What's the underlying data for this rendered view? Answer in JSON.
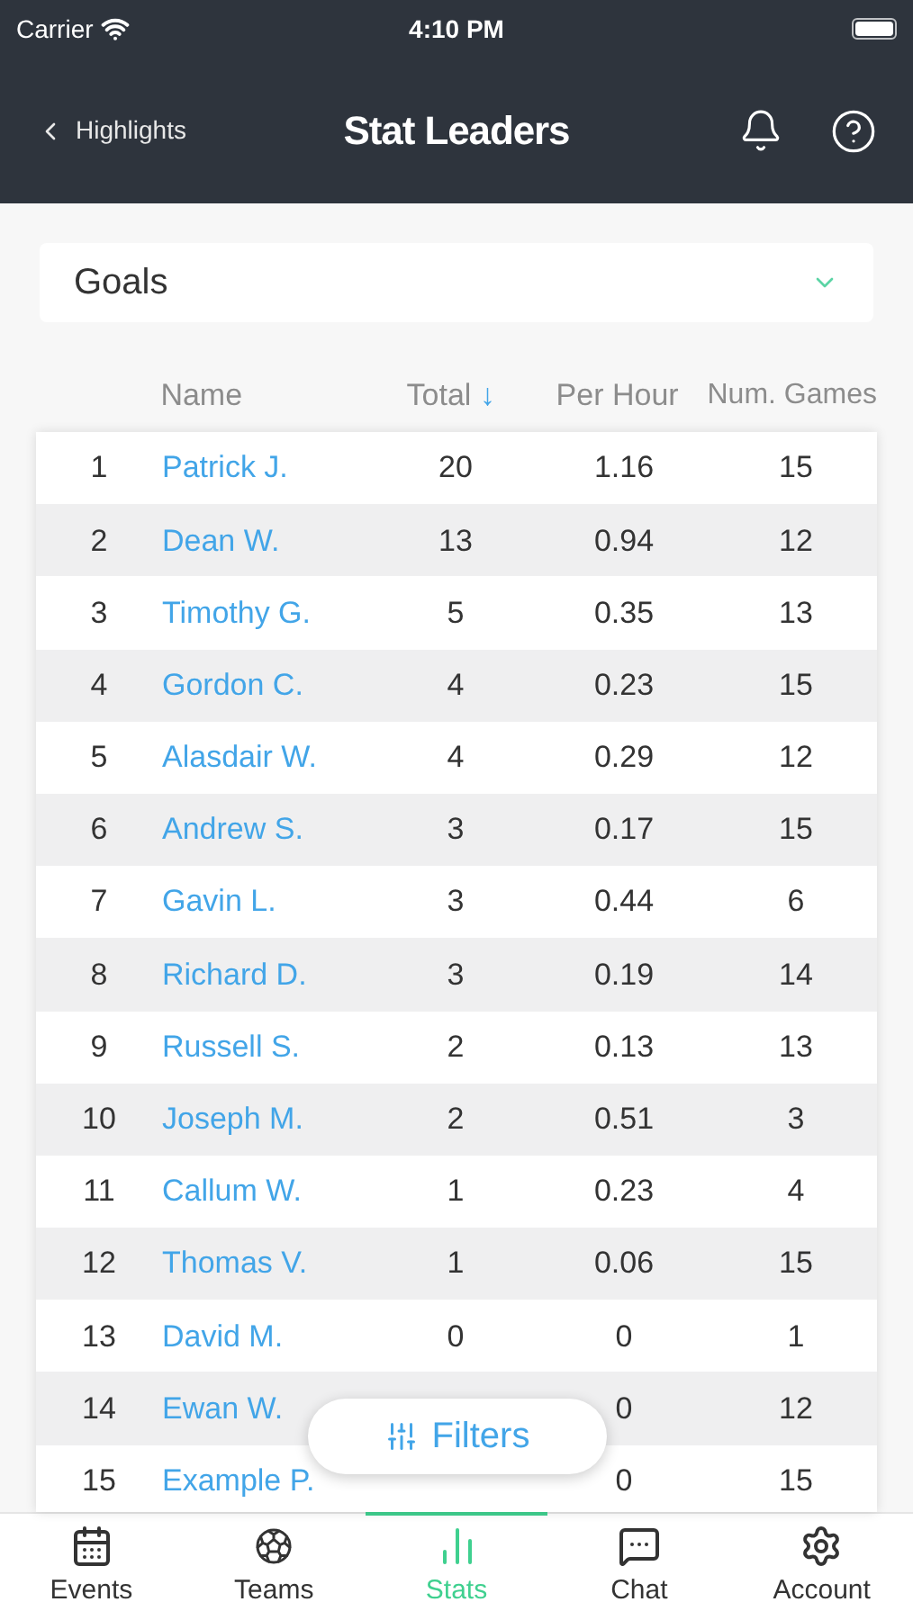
{
  "status_bar": {
    "carrier": "Carrier",
    "time": "4:10 PM"
  },
  "nav": {
    "back_label": "Highlights",
    "title": "Stat Leaders"
  },
  "stat_select": {
    "value": "Goals"
  },
  "table": {
    "columns": [
      {
        "label": "Name"
      },
      {
        "label": "Total",
        "sort_arrow": "↓"
      },
      {
        "label": "Per Hour"
      },
      {
        "label": "Num. Games"
      }
    ],
    "rows": [
      {
        "rank": "1",
        "name": "Patrick J.",
        "total": "20",
        "per_hour": "1.16",
        "games": "15"
      },
      {
        "rank": "2",
        "name": "Dean W.",
        "total": "13",
        "per_hour": "0.94",
        "games": "12"
      },
      {
        "rank": "3",
        "name": "Timothy G.",
        "total": "5",
        "per_hour": "0.35",
        "games": "13"
      },
      {
        "rank": "4",
        "name": "Gordon C.",
        "total": "4",
        "per_hour": "0.23",
        "games": "15"
      },
      {
        "rank": "5",
        "name": "Alasdair W.",
        "total": "4",
        "per_hour": "0.29",
        "games": "12"
      },
      {
        "rank": "6",
        "name": "Andrew S.",
        "total": "3",
        "per_hour": "0.17",
        "games": "15"
      },
      {
        "rank": "7",
        "name": "Gavin L.",
        "total": "3",
        "per_hour": "0.44",
        "games": "6"
      },
      {
        "rank": "8",
        "name": "Richard D.",
        "total": "3",
        "per_hour": "0.19",
        "games": "14"
      },
      {
        "rank": "9",
        "name": "Russell S.",
        "total": "2",
        "per_hour": "0.13",
        "games": "13"
      },
      {
        "rank": "10",
        "name": "Joseph M.",
        "total": "2",
        "per_hour": "0.51",
        "games": "3"
      },
      {
        "rank": "11",
        "name": "Callum W.",
        "total": "1",
        "per_hour": "0.23",
        "games": "4"
      },
      {
        "rank": "12",
        "name": "Thomas V.",
        "total": "1",
        "per_hour": "0.06",
        "games": "15"
      },
      {
        "rank": "13",
        "name": "David M.",
        "total": "0",
        "per_hour": "0",
        "games": "1"
      },
      {
        "rank": "14",
        "name": "Ewan W.",
        "per_hour": "0",
        "games": "12"
      },
      {
        "rank": "15",
        "name": "Example P.",
        "per_hour": "0",
        "games": "15"
      }
    ]
  },
  "filters_button": {
    "label": "Filters"
  },
  "tab_bar": [
    {
      "kind": "events",
      "label": "Events",
      "selected": false
    },
    {
      "kind": "teams",
      "label": "Teams",
      "selected": false
    },
    {
      "kind": "stats",
      "label": "Stats",
      "selected": true
    },
    {
      "kind": "chat",
      "label": "Chat",
      "selected": false
    },
    {
      "kind": "account",
      "label": "Account",
      "selected": false
    }
  ]
}
